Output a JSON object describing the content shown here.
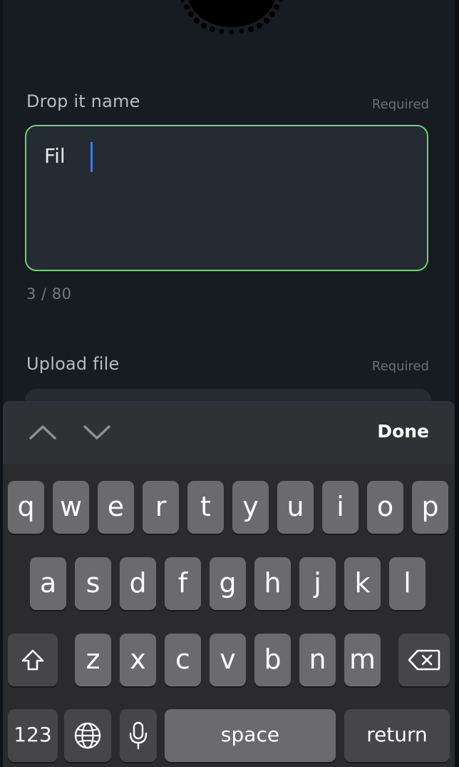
{
  "form": {
    "name_field": {
      "label": "Drop it name",
      "required_label": "Required",
      "value": "Fil",
      "counter": "3 / 80"
    },
    "upload_field": {
      "label": "Upload file",
      "required_label": "Required"
    }
  },
  "accessory_bar": {
    "prev_icon": "chevron-up-icon",
    "next_icon": "chevron-down-icon",
    "done_label": "Done"
  },
  "keyboard": {
    "row1": [
      "q",
      "w",
      "e",
      "r",
      "t",
      "y",
      "u",
      "i",
      "o",
      "p"
    ],
    "row2": [
      "a",
      "s",
      "d",
      "f",
      "g",
      "h",
      "j",
      "k",
      "l"
    ],
    "row3": [
      "z",
      "x",
      "c",
      "v",
      "b",
      "n",
      "m"
    ],
    "shift_icon": "shift-icon",
    "backspace_icon": "backspace-icon",
    "numbers_label": "123",
    "globe_icon": "globe-icon",
    "mic_icon": "microphone-icon",
    "space_label": "space",
    "return_label": "return"
  },
  "colors": {
    "background": "#171b22",
    "input_border_focus": "#6bd26f",
    "caret": "#3a7bff",
    "key": "#6b6b6e",
    "key_dark": "#464649",
    "keyboard_bg": "#2b2b2d"
  }
}
